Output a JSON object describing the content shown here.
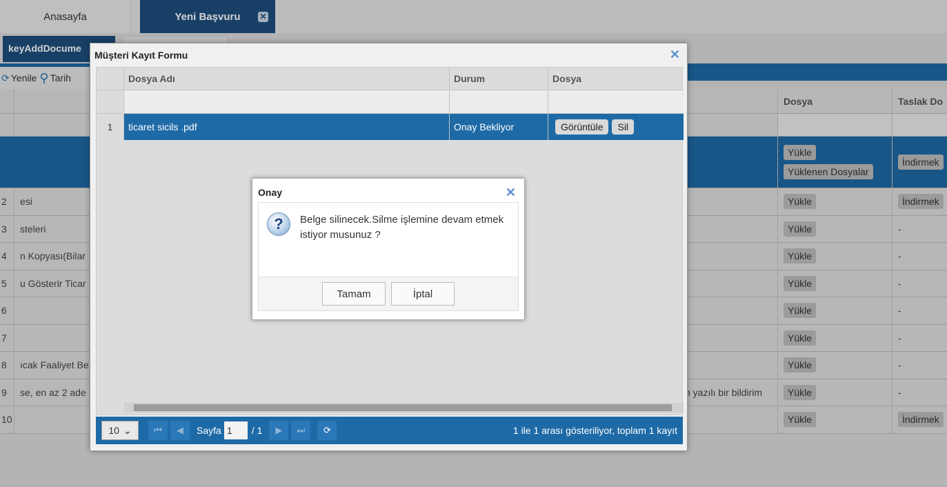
{
  "tabs": {
    "home": "Anasayfa",
    "new_app": "Yeni Başvuru",
    "close": "✕"
  },
  "subtab": {
    "label": "keyAddDocume"
  },
  "toolbar": {
    "refresh": "Yenile",
    "date": "Tarih"
  },
  "bg_table": {
    "headers": {
      "dosya": "Dosya",
      "taslak": "Taslak Do"
    },
    "rows": [
      {
        "num": "2",
        "name": "esi",
        "info": "",
        "btn": "Yükle",
        "draft": "İndirmek"
      },
      {
        "num": "3",
        "name": "steleri",
        "info": "",
        "btn": "Yükle",
        "draft": "-"
      },
      {
        "num": "4",
        "name": "n Kopyası(Bilar",
        "info": "",
        "btn": "Yükle",
        "draft": "-"
      },
      {
        "num": "5",
        "name": "u Gösterir Ticar",
        "info": "",
        "btn": "Yükle",
        "draft": "-"
      },
      {
        "num": "6",
        "name": "",
        "info": "",
        "btn": "Yükle",
        "draft": "-"
      },
      {
        "num": "7",
        "name": "",
        "info": "",
        "btn": "Yükle",
        "draft": "-"
      },
      {
        "num": "8",
        "name": "ıcak Faaliyet Be",
        "info": "",
        "btn": "Yükle",
        "draft": "-"
      },
      {
        "num": "9",
        "name": "se, en az 2 ade",
        "info": "n yazılı bir bildirim",
        "btn": "Yükle",
        "draft": "-"
      },
      {
        "num": "10",
        "name": "",
        "info": "",
        "btn": "Yükle",
        "draft": "İndirmek"
      }
    ],
    "first_row": {
      "upload": "Yükle",
      "uploaded": "Yüklenen Dosyalar",
      "draft": "İndirmek"
    }
  },
  "window": {
    "title": "Müşteri Kayıt Formu",
    "columns": {
      "name": "Dosya Adı",
      "status": "Durum",
      "file": "Dosya"
    },
    "row": {
      "num": "1",
      "name": "ticaret sicils .pdf",
      "status": "Onay Bekliyor",
      "view": "Görüntüle",
      "delete": "Sil"
    },
    "pager": {
      "page_size": "10",
      "page_label": "Sayfa",
      "page": "1",
      "total_pages": "/ 1",
      "summary": "1 ile 1 arası gösteriliyor, toplam 1 kayıt"
    }
  },
  "dialog": {
    "title": "Onay",
    "message": "Belge silinecek.Silme işlemine devam etmek istiyor musunuz ?",
    "ok": "Tamam",
    "cancel": "İptal",
    "close": "✕"
  },
  "colors": {
    "accent": "#1e6aa6",
    "tab_active": "#1e4f7e"
  }
}
